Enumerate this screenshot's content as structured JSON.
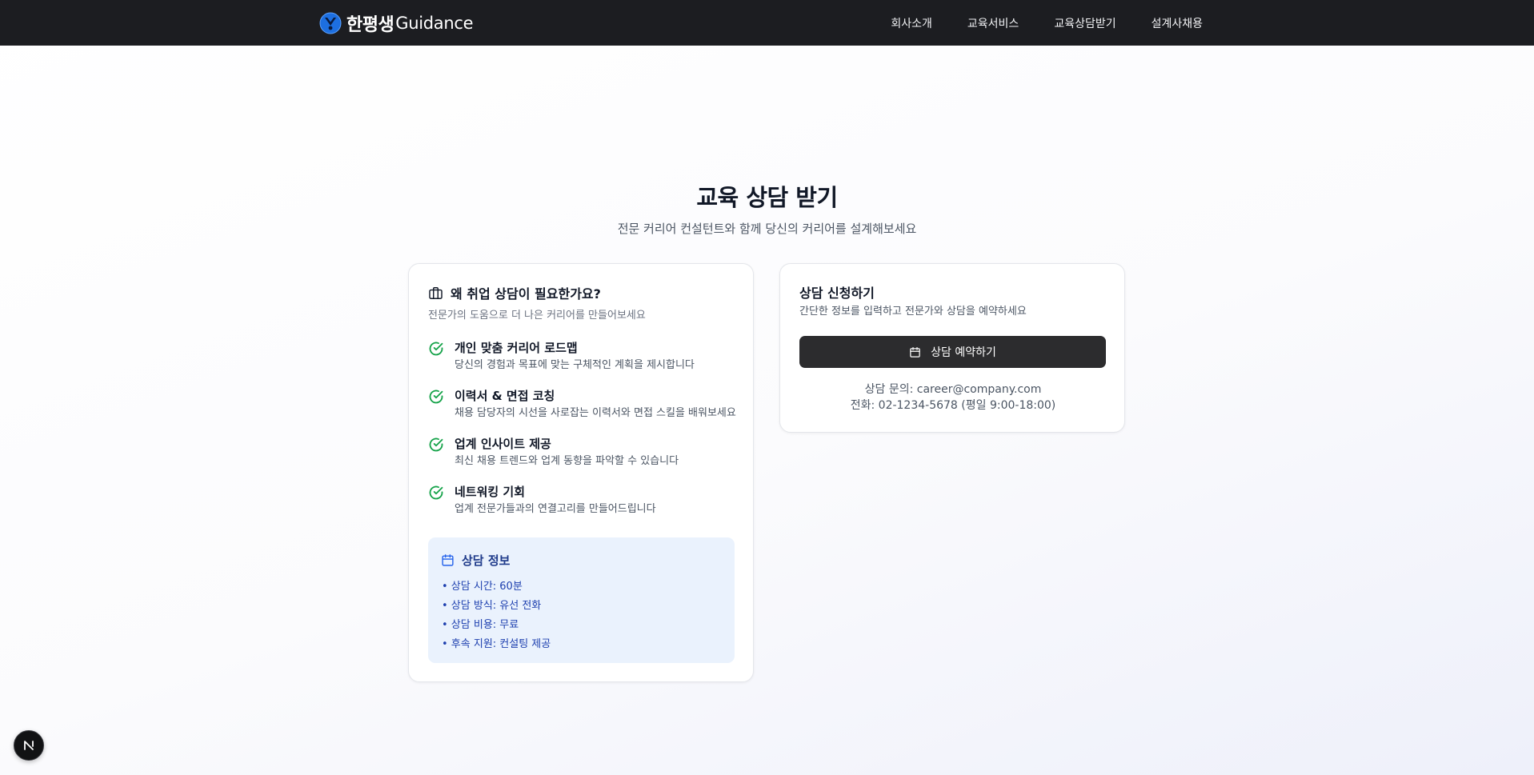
{
  "header": {
    "brand_ko": "한평생",
    "brand_en": "Guidance",
    "nav": [
      {
        "label": "회사소개"
      },
      {
        "label": "교육서비스"
      },
      {
        "label": "교육상담받기"
      },
      {
        "label": "설계사채용"
      }
    ],
    "colors": {
      "background": "#1c1d21",
      "logo": "#1d6fe0"
    }
  },
  "hero": {
    "title": "교육 상담 받기",
    "subtitle": "전문 커리어 컨설턴트와 함께 당신의 커리어를 설계해보세요"
  },
  "why_card": {
    "icon": "briefcase-icon",
    "title": "왜 취업 상담이 필요한가요?",
    "description": "전문가의 도움으로 더 나은 커리어를 만들어보세요",
    "features": [
      {
        "icon": "check-circle-icon",
        "title": "개인 맞춤 커리어 로드맵",
        "description": "당신의 경험과 목표에 맞는 구체적인 계획을 제시합니다"
      },
      {
        "icon": "check-circle-icon",
        "title": "이력서 & 면접 코칭",
        "description": "채용 담당자의 시선을 사로잡는 이력서와 면접 스킬을 배워보세요"
      },
      {
        "icon": "check-circle-icon",
        "title": "업계 인사이트 제공",
        "description": "최신 채용 트렌드와 업계 동향을 파악할 수 있습니다"
      },
      {
        "icon": "check-circle-icon",
        "title": "네트워킹 기회",
        "description": "업계 전문가들과의 연결고리를 만들어드립니다"
      }
    ],
    "info": {
      "icon": "calendar-icon",
      "title": "상담 정보",
      "items": [
        "• 상담 시간: 60분",
        "• 상담 방식: 유선 전화",
        "• 상담 비용: 무료",
        "• 후속 지원: 컨설팅 제공"
      ],
      "colors": {
        "background": "#eaf2fd",
        "text": "#1e40af"
      }
    }
  },
  "apply_card": {
    "title": "상담 신청하기",
    "description": "간단한 정보를 입력하고 전문가와 상담을 예약하세요",
    "button": {
      "icon": "calendar-icon",
      "label": "상담 예약하기"
    },
    "contact_email": "상담 문의: career@company.com",
    "contact_phone": "전화: 02-1234-5678 (평일 9:00-18:00)"
  },
  "floating_badge": {
    "label": "N",
    "icon": "n-logo-icon"
  },
  "accent_colors": {
    "check": "#16a34a",
    "button": "#2c2c2e"
  }
}
